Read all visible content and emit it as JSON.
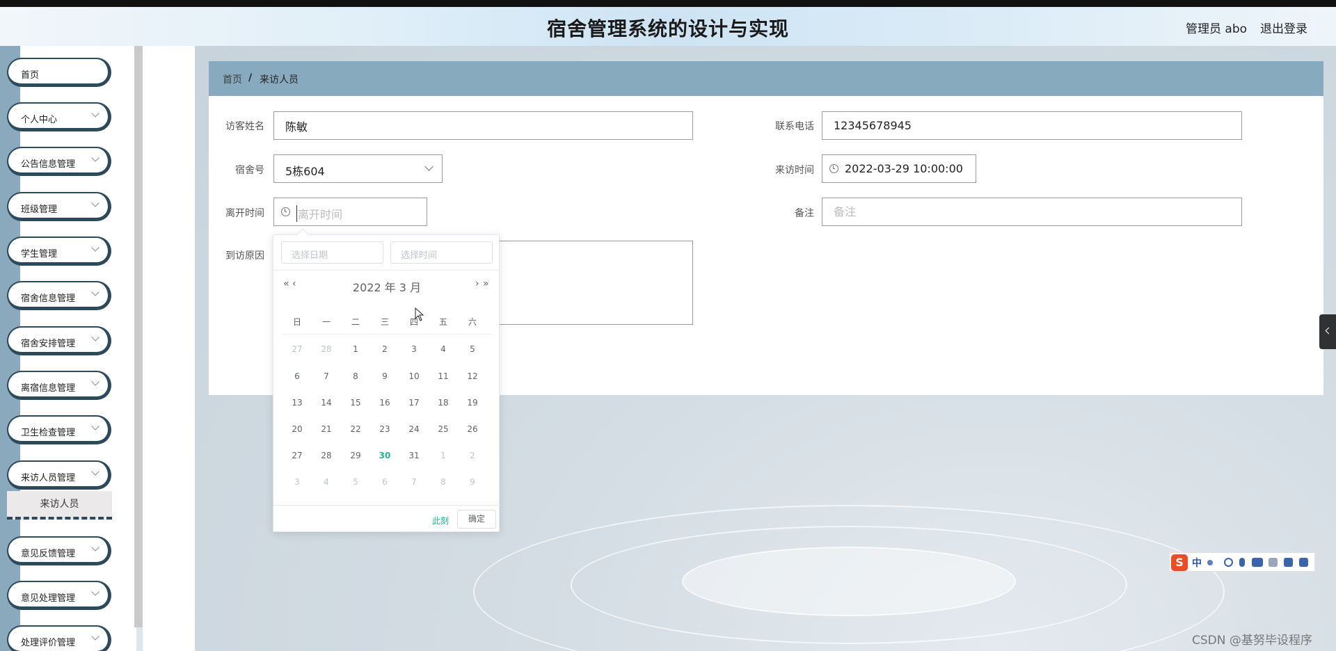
{
  "header": {
    "title": "宿舍管理系统的设计与实现",
    "user": "管理员 abo",
    "logout": "退出登录"
  },
  "sidebar": {
    "items": [
      {
        "label": "首页",
        "has_arrow": false
      },
      {
        "label": "个人中心",
        "has_arrow": true
      },
      {
        "label": "公告信息管理",
        "has_arrow": true
      },
      {
        "label": "班级管理",
        "has_arrow": true
      },
      {
        "label": "学生管理",
        "has_arrow": true
      },
      {
        "label": "宿舍信息管理",
        "has_arrow": true
      },
      {
        "label": "宿舍安排管理",
        "has_arrow": true
      },
      {
        "label": "离宿信息管理",
        "has_arrow": true
      },
      {
        "label": "卫生检查管理",
        "has_arrow": true
      },
      {
        "label": "来访人员管理",
        "has_arrow": true
      },
      {
        "label": "意见反馈管理",
        "has_arrow": true
      },
      {
        "label": "意见处理管理",
        "has_arrow": true
      },
      {
        "label": "处理评价管理",
        "has_arrow": true
      }
    ],
    "submenu": "来访人员"
  },
  "breadcrumb": {
    "home": "首页",
    "separator": "/",
    "current": "来访人员"
  },
  "form": {
    "visitor_name": {
      "label": "访客姓名",
      "value": "陈敏"
    },
    "phone": {
      "label": "联系电话",
      "value": "12345678945"
    },
    "dorm": {
      "label": "宿舍号",
      "value": "5栋604"
    },
    "visit_time": {
      "label": "来访时间",
      "value": "2022-03-29 10:00:00"
    },
    "leave_time": {
      "label": "离开时间",
      "placeholder": "离开时间"
    },
    "remark": {
      "label": "备注",
      "placeholder": "备注"
    },
    "reason": {
      "label": "到访原因"
    }
  },
  "datepicker": {
    "date_placeholder": "选择日期",
    "time_placeholder": "选择时间",
    "nav_prev_year": "«",
    "nav_prev_month": "‹",
    "nav_next_month": "›",
    "nav_next_year": "»",
    "year_month": "2022 年  3 月",
    "weekdays": [
      "日",
      "一",
      "二",
      "三",
      "四",
      "五",
      "六"
    ],
    "weeks": [
      [
        {
          "d": "27",
          "m": true
        },
        {
          "d": "28",
          "m": true
        },
        {
          "d": "1"
        },
        {
          "d": "2"
        },
        {
          "d": "3"
        },
        {
          "d": "4"
        },
        {
          "d": "5"
        }
      ],
      [
        {
          "d": "6"
        },
        {
          "d": "7"
        },
        {
          "d": "8"
        },
        {
          "d": "9"
        },
        {
          "d": "10"
        },
        {
          "d": "11"
        },
        {
          "d": "12"
        }
      ],
      [
        {
          "d": "13"
        },
        {
          "d": "14"
        },
        {
          "d": "15"
        },
        {
          "d": "16"
        },
        {
          "d": "17"
        },
        {
          "d": "18"
        },
        {
          "d": "19"
        }
      ],
      [
        {
          "d": "20"
        },
        {
          "d": "21"
        },
        {
          "d": "22"
        },
        {
          "d": "23"
        },
        {
          "d": "24"
        },
        {
          "d": "25"
        },
        {
          "d": "26"
        }
      ],
      [
        {
          "d": "27"
        },
        {
          "d": "28"
        },
        {
          "d": "29"
        },
        {
          "d": "30",
          "today": true
        },
        {
          "d": "31"
        },
        {
          "d": "1",
          "m": true
        },
        {
          "d": "2",
          "m": true
        }
      ],
      [
        {
          "d": "3",
          "m": true
        },
        {
          "d": "4",
          "m": true
        },
        {
          "d": "5",
          "m": true
        },
        {
          "d": "6",
          "m": true
        },
        {
          "d": "7",
          "m": true
        },
        {
          "d": "8",
          "m": true
        },
        {
          "d": "9",
          "m": true
        }
      ]
    ],
    "now_label": "此刻",
    "confirm_label": "确定"
  },
  "ime": {
    "logo": "S",
    "mode": "中"
  },
  "watermark": "CSDN @基努毕设程序",
  "colors": {
    "accent": "#20b589",
    "breadcrumb_bg": "#88aabe",
    "menu_border": "#2c4a5c"
  }
}
